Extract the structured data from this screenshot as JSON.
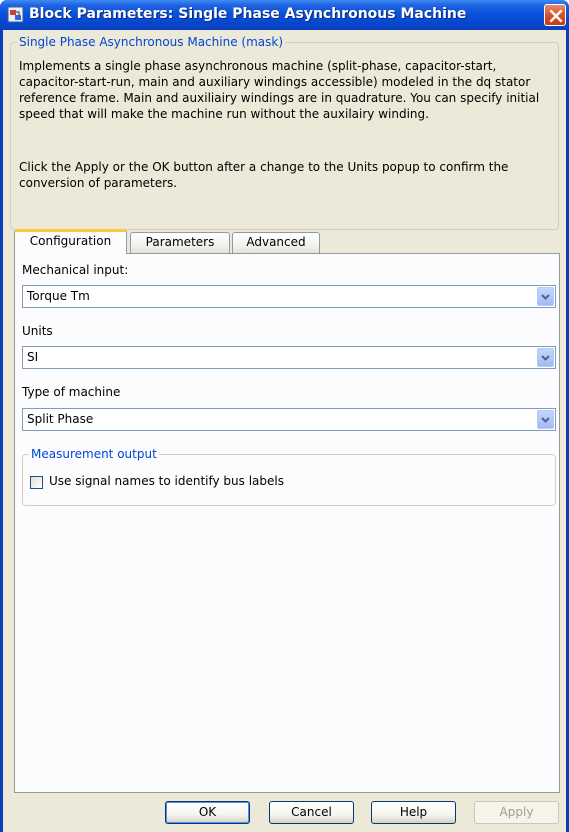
{
  "window": {
    "title": "Block Parameters: Single Phase Asynchronous Machine",
    "icon": "simulink-block-icon"
  },
  "mask": {
    "legend": "Single Phase Asynchronous Machine (mask)",
    "description": "Implements a single phase asynchronous machine (split-phase, capacitor-start, capacitor-start-run,  main and auxiliary windings accessible) modeled in the dq stator reference frame. Main and auxiliairy windings are in quadrature. You can specify initial speed that will make the machine run without the auxilairy winding.",
    "note": "Click the Apply or the OK button after a change to the Units popup to confirm the conversion of parameters."
  },
  "tabs": [
    {
      "label": "Configuration",
      "active": true
    },
    {
      "label": "Parameters",
      "active": false
    },
    {
      "label": "Advanced",
      "active": false
    }
  ],
  "config": {
    "mechanical_input": {
      "label": "Mechanical input:",
      "value": "Torque Tm"
    },
    "units": {
      "label": "Units",
      "value": "SI"
    },
    "machine_type": {
      "label": "Type of machine",
      "value": "Split Phase"
    },
    "measurement": {
      "legend": "Measurement output",
      "checkbox_label": "Use signal names to identify bus labels",
      "checked": false
    }
  },
  "buttons": {
    "ok": "OK",
    "cancel": "Cancel",
    "help": "Help",
    "apply": "Apply",
    "apply_enabled": false
  },
  "colors": {
    "titlebar": "#0a52dc",
    "legend_text": "#0046d5",
    "dialog_bg": "#ece9d8",
    "tab_highlight": "#ffc83c"
  }
}
